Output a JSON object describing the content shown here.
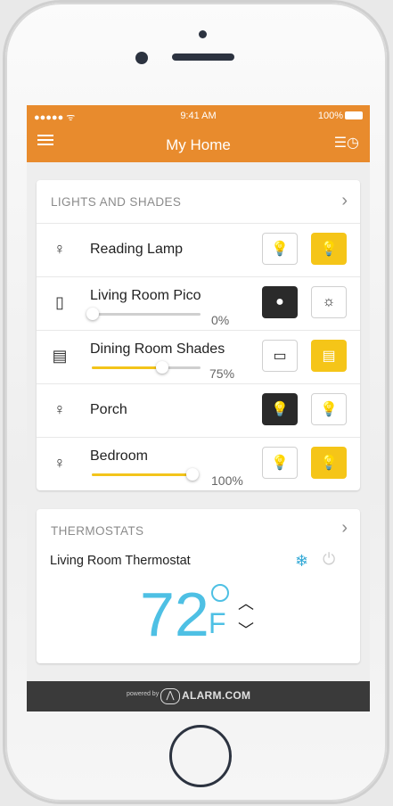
{
  "status": {
    "signal": "●●●●● ᯤ",
    "time": "9:41 AM",
    "battery": "100%"
  },
  "header": {
    "title": "My Home"
  },
  "lights": {
    "heading": "LIGHTS AND SHADES",
    "items": [
      {
        "label": "Reading Lamp"
      },
      {
        "label": "Living Room Pico",
        "pct": "0%",
        "level": 0
      },
      {
        "label": "Dining Room Shades",
        "pct": "75%",
        "level": 0.75
      },
      {
        "label": "Porch"
      },
      {
        "label": "Bedroom",
        "pct": "100%",
        "level": 1.0
      }
    ]
  },
  "thermostats": {
    "heading": "THERMOSTATS",
    "name": "Living Room Thermostat",
    "temp": "72",
    "unit": "F"
  },
  "footer": {
    "powered": "powered by",
    "brand": "ALARM.COM"
  },
  "colors": {
    "accent": "#e88b2d",
    "yellow": "#f5c518",
    "temp": "#4ec0e4"
  }
}
